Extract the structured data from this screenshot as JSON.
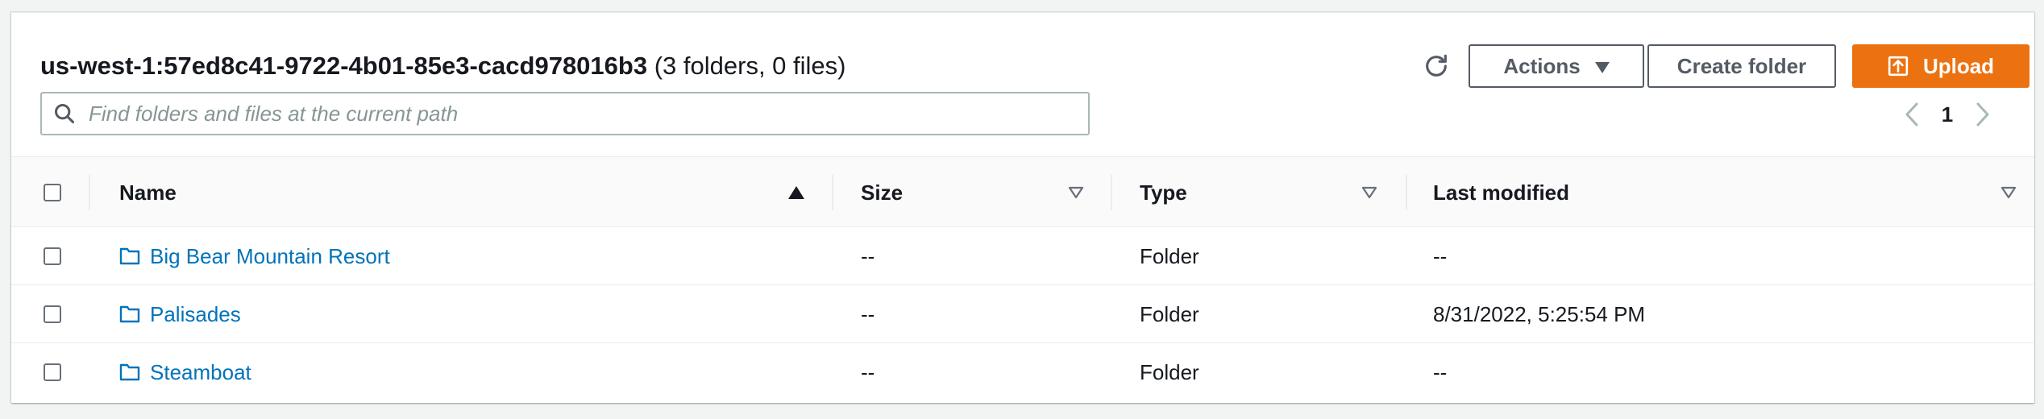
{
  "header": {
    "path": "us-west-1:57ed8c41-9722-4b01-85e3-cacd978016b3",
    "count": "(3 folders, 0 files)"
  },
  "toolbar": {
    "refresh_icon": "refresh-icon",
    "actions_label": "Actions",
    "create_folder_label": "Create folder",
    "upload_label": "Upload"
  },
  "search": {
    "placeholder": "Find folders and files at the current path",
    "value": ""
  },
  "pagination": {
    "current_page": "1"
  },
  "table": {
    "columns": {
      "name": "Name",
      "size": "Size",
      "type": "Type",
      "last_modified": "Last modified"
    },
    "rows": [
      {
        "name": "Big Bear Mountain Resort",
        "size": "--",
        "type": "Folder",
        "last_modified": "--"
      },
      {
        "name": "Palisades",
        "size": "--",
        "type": "Folder",
        "last_modified": "8/31/2022, 5:25:54 PM"
      },
      {
        "name": "Steamboat",
        "size": "--",
        "type": "Folder",
        "last_modified": "--"
      }
    ]
  },
  "colors": {
    "accent": "#ec7211",
    "link": "#0073bb",
    "border": "#aab7b8"
  }
}
